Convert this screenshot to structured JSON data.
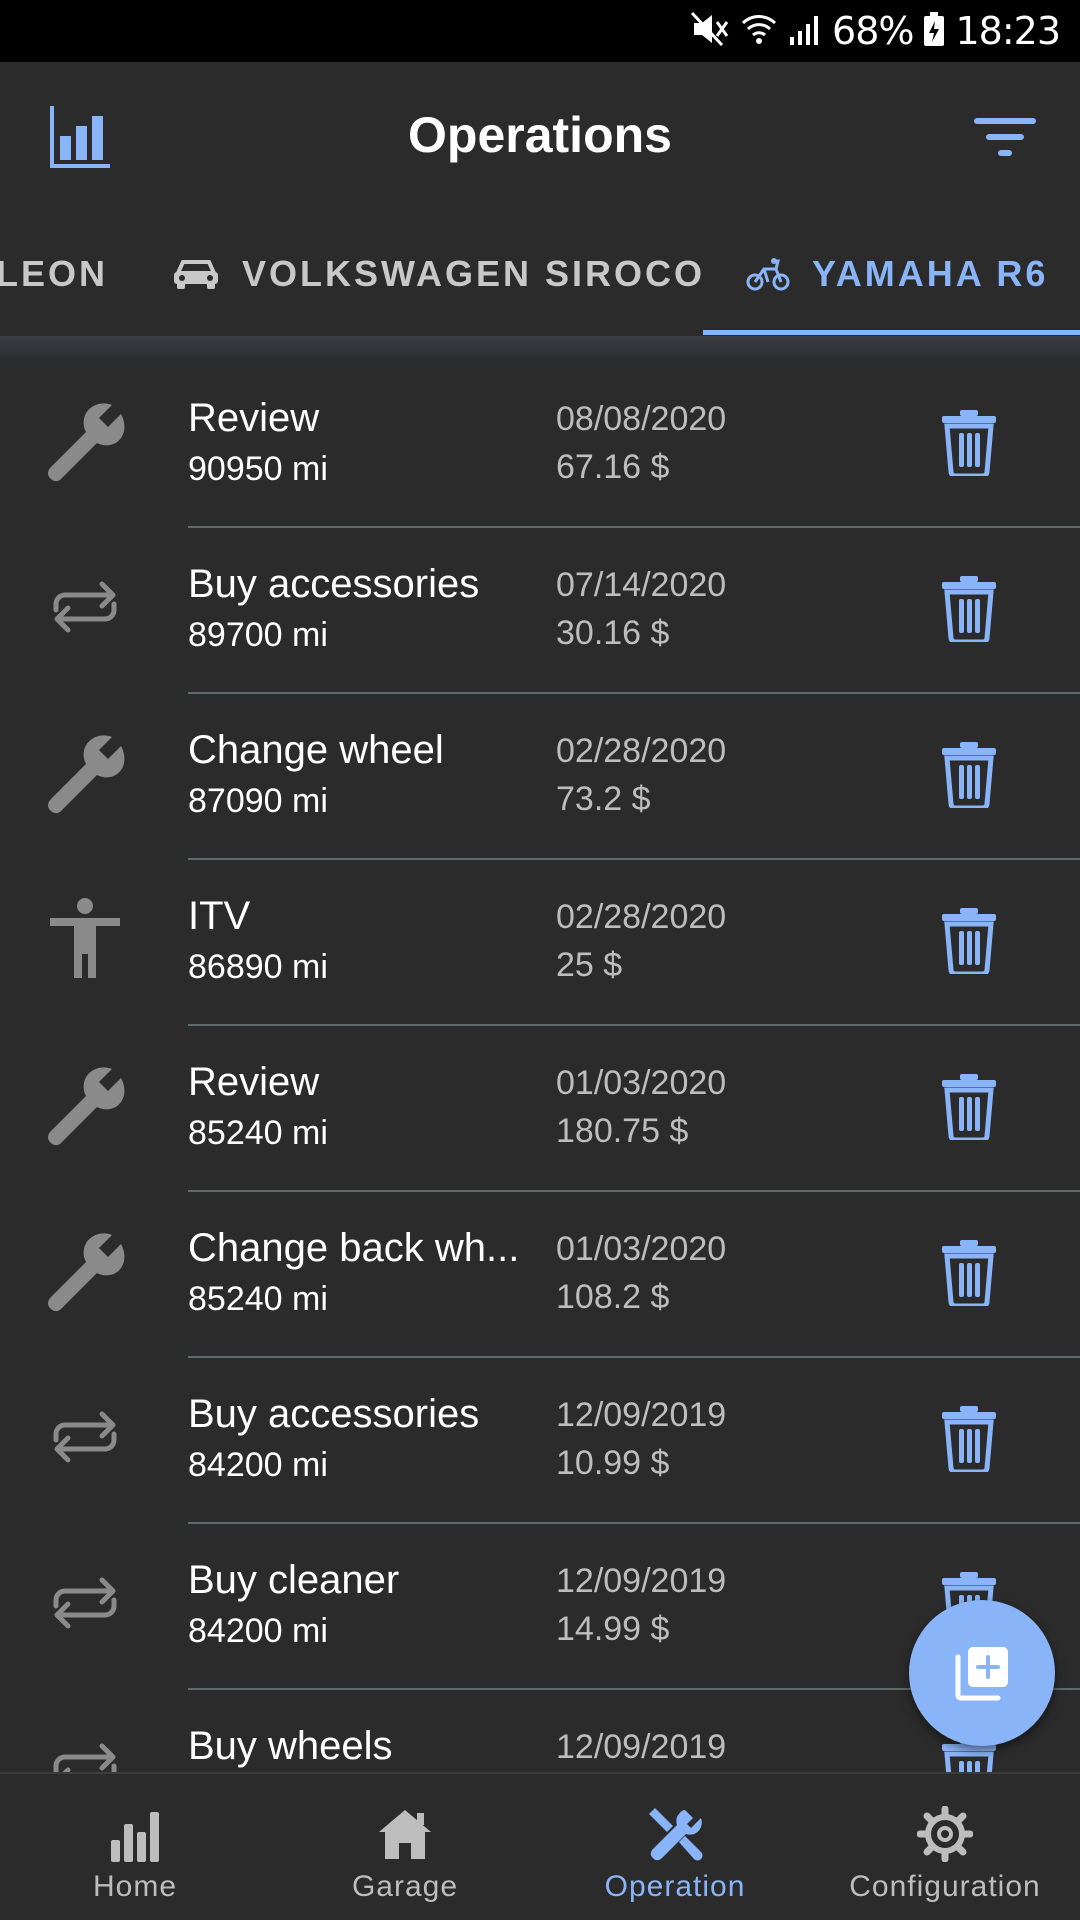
{
  "status_bar": {
    "battery": "68%",
    "time": "18:23"
  },
  "header": {
    "title": "Operations"
  },
  "tabs": [
    {
      "label": "LEON",
      "icon": "car-icon",
      "active": false
    },
    {
      "label": "VOLKSWAGEN SIROCO",
      "icon": "car-icon",
      "active": false
    },
    {
      "label": "YAMAHA R6",
      "icon": "bicycle-icon",
      "active": true
    }
  ],
  "operations": [
    {
      "title": "Review",
      "mileage": "90950 mi",
      "date": "08/08/2020",
      "price": "67.16 $",
      "icon": "wrench-icon"
    },
    {
      "title": "Buy accessories",
      "mileage": "89700 mi",
      "date": "07/14/2020",
      "price": "30.16 $",
      "icon": "repeat-icon"
    },
    {
      "title": "Change wheel",
      "mileage": "87090 mi",
      "date": "02/28/2020",
      "price": "73.2 $",
      "icon": "wrench-icon"
    },
    {
      "title": "ITV",
      "mileage": "86890 mi",
      "date": "02/28/2020",
      "price": "25 $",
      "icon": "person-icon"
    },
    {
      "title": "Review",
      "mileage": "85240 mi",
      "date": "01/03/2020",
      "price": "180.75 $",
      "icon": "wrench-icon"
    },
    {
      "title": "Change back wh...",
      "mileage": "85240 mi",
      "date": "01/03/2020",
      "price": "108.2 $",
      "icon": "wrench-icon"
    },
    {
      "title": "Buy accessories",
      "mileage": "84200 mi",
      "date": "12/09/2019",
      "price": "10.99 $",
      "icon": "repeat-icon"
    },
    {
      "title": "Buy cleaner",
      "mileage": "84200 mi",
      "date": "12/09/2019",
      "price": "14.99 $",
      "icon": "repeat-icon"
    },
    {
      "title": "Buy wheels",
      "mileage": "",
      "date": "12/09/2019",
      "price": "",
      "icon": "repeat-icon"
    }
  ],
  "bottom_nav": [
    {
      "label": "Home",
      "icon": "bar-chart-icon",
      "active": false
    },
    {
      "label": "Garage",
      "icon": "house-icon",
      "active": false
    },
    {
      "label": "Operation",
      "icon": "tools-icon",
      "active": true
    },
    {
      "label": "Configuration",
      "icon": "gear-icon",
      "active": false
    }
  ],
  "colors": {
    "accent": "#8ab4f8",
    "background": "#2b2b2b",
    "divider": "#5f6b6b",
    "icon_gray": "#8a8a8a"
  }
}
